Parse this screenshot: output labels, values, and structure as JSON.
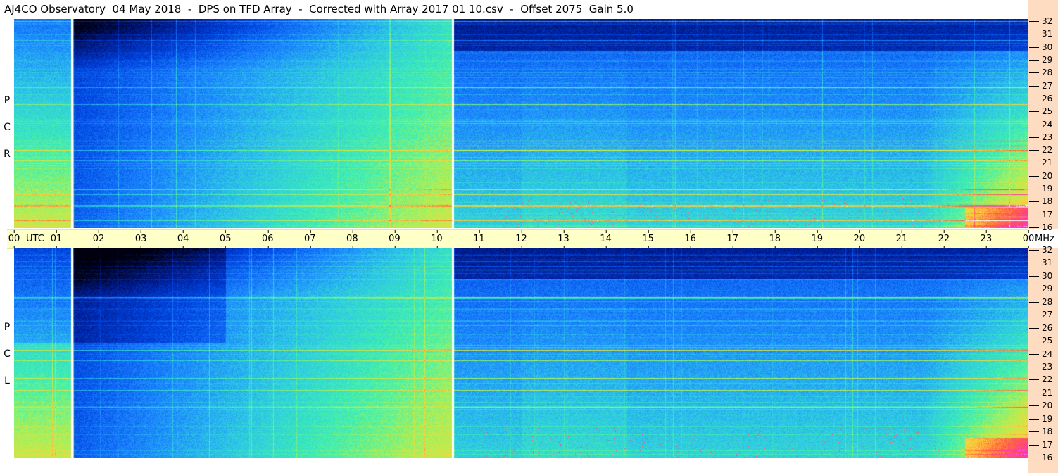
{
  "title": "AJ4CO Observatory  04 May 2018  -  DPS on TFD Array  -  Corrected with Array 2017 01 10.csv  -  Offset 2075  Gain 5.0",
  "panels": [
    {
      "label_letters": [
        "R",
        "C",
        "P"
      ]
    },
    {
      "label_letters": [
        "L",
        "C",
        "P"
      ]
    }
  ],
  "time_axis": {
    "ticks": [
      "00",
      "01",
      "02",
      "03",
      "04",
      "05",
      "06",
      "07",
      "08",
      "09",
      "10",
      "11",
      "12",
      "13",
      "14",
      "15",
      "16",
      "17",
      "18",
      "19",
      "20",
      "21",
      "22",
      "23",
      "00"
    ],
    "utc_label": "UTC",
    "freq_unit": "MHz"
  },
  "freq_axis": {
    "ticks": [
      "32",
      "31",
      "30",
      "29",
      "28",
      "27",
      "26",
      "25",
      "24",
      "23",
      "22",
      "21",
      "20",
      "19",
      "18",
      "17",
      "16"
    ]
  },
  "colors": {
    "colormap": [
      "#000010",
      "#001a8c",
      "#0044e0",
      "#1a82ff",
      "#2ec8e6",
      "#3ef0b0",
      "#b4f050",
      "#ffd23c",
      "#ff643c",
      "#ff28c8",
      "#ffffff"
    ],
    "gap_line": "#ffffff",
    "time_band": "#ffffc8",
    "tick_strip": "#fddcc2"
  },
  "chart_data": {
    "type": "heatmap",
    "title": "AJ4CO Observatory  04 May 2018  -  DPS on TFD Array  -  Corrected with Array 2017 01 10.csv  -  Offset 2075  Gain 5.0",
    "xlabel": "UTC",
    "ylabel": "MHz",
    "x_range_utc_hours": [
      0,
      24
    ],
    "y_range_mhz": [
      16,
      32
    ],
    "series": [
      {
        "name": "RCP"
      },
      {
        "name": "LCP"
      }
    ],
    "data_gaps_utc_hours": [
      1.37,
      10.37
    ]
  }
}
